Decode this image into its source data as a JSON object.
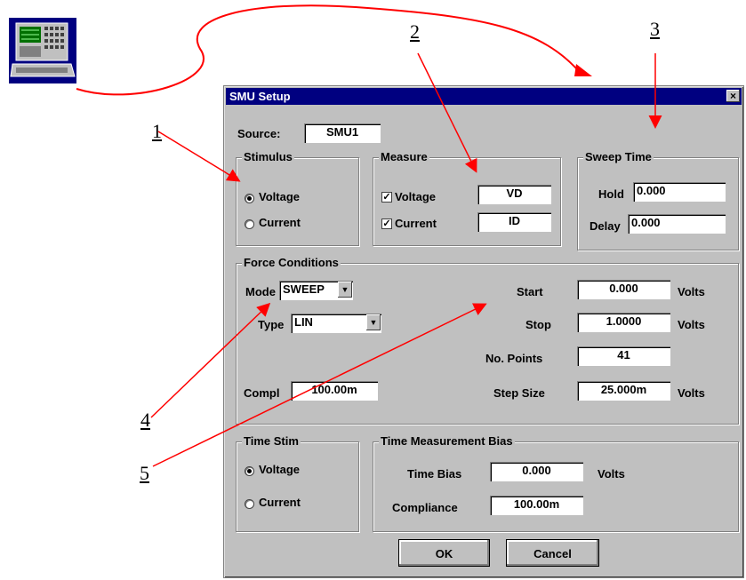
{
  "window": {
    "title": "SMU Setup",
    "close_glyph": "×"
  },
  "callouts": [
    "1",
    "2",
    "3",
    "4",
    "5"
  ],
  "source": {
    "label": "Source:",
    "value": "SMU1"
  },
  "stimulus": {
    "legend": "Stimulus",
    "options": [
      {
        "label": "Voltage",
        "selected": true
      },
      {
        "label": "Current",
        "selected": false
      }
    ]
  },
  "measure": {
    "legend": "Measure",
    "rows": [
      {
        "label": "Voltage",
        "checked": true,
        "value": "VD"
      },
      {
        "label": "Current",
        "checked": true,
        "value": "ID"
      }
    ]
  },
  "sweep_time": {
    "legend": "Sweep Time",
    "hold_label": "Hold",
    "hold_value": "0.000",
    "delay_label": "Delay",
    "delay_value": "0.000"
  },
  "force": {
    "legend": "Force Conditions",
    "mode_label": "Mode",
    "mode_value": "SWEEP",
    "type_label": "Type",
    "type_value": "LIN",
    "compl_label": "Compl",
    "compl_value": "100.00m",
    "start_label": "Start",
    "start_value": "0.000",
    "start_unit": "Volts",
    "stop_label": "Stop",
    "stop_value": "1.0000",
    "stop_unit": "Volts",
    "points_label": "No. Points",
    "points_value": "41",
    "step_label": "Step Size",
    "step_value": "25.000m",
    "step_unit": "Volts"
  },
  "time_stim": {
    "legend": "Time Stim",
    "options": [
      {
        "label": "Voltage",
        "selected": true
      },
      {
        "label": "Current",
        "selected": false
      }
    ]
  },
  "time_bias": {
    "legend": "Time Measurement Bias",
    "bias_label": "Time Bias",
    "bias_value": "0.000",
    "bias_unit": "Volts",
    "compliance_label": "Compliance",
    "compliance_value": "100.00m"
  },
  "buttons": {
    "ok": "OK",
    "cancel": "Cancel"
  },
  "colors": {
    "title_bar": "#000080",
    "dialog": "#c0c0c0",
    "arrow": "#ff0000"
  }
}
